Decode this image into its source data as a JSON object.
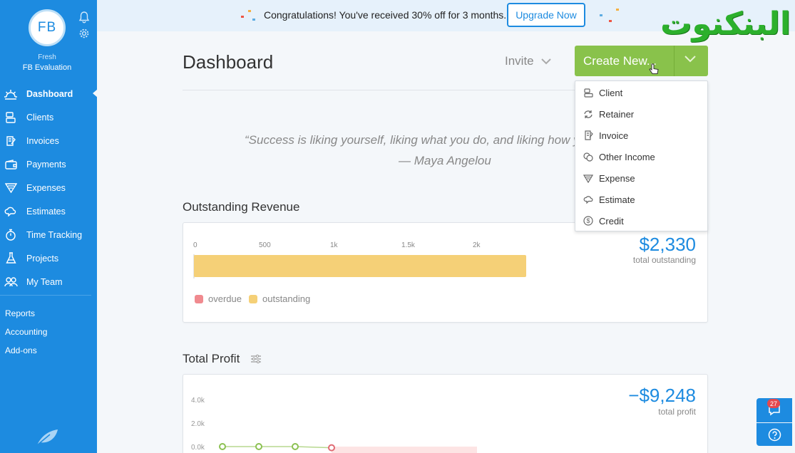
{
  "sidebar": {
    "avatar_initials": "FB",
    "org_subtitle": "Fresh",
    "org_name": "FB Evaluation",
    "items": [
      {
        "label": "Dashboard",
        "icon": "sun-icon",
        "active": true
      },
      {
        "label": "Clients",
        "icon": "clients-icon"
      },
      {
        "label": "Invoices",
        "icon": "invoice-icon"
      },
      {
        "label": "Payments",
        "icon": "wallet-icon"
      },
      {
        "label": "Expenses",
        "icon": "expense-icon"
      },
      {
        "label": "Estimates",
        "icon": "cloud-icon"
      },
      {
        "label": "Time Tracking",
        "icon": "stopwatch-icon"
      },
      {
        "label": "Projects",
        "icon": "flask-icon"
      },
      {
        "label": "My Team",
        "icon": "team-icon"
      }
    ],
    "links": [
      "Reports",
      "Accounting",
      "Add-ons"
    ]
  },
  "banner": {
    "message": "Congratulations! You've received 30% off for 3 months.",
    "button": "Upgrade Now"
  },
  "watermark": "البنكنوت",
  "header": {
    "title": "Dashboard",
    "invite": "Invite",
    "create": "Create New..."
  },
  "dropdown": {
    "items": [
      {
        "label": "Client",
        "icon": "client-icon"
      },
      {
        "label": "Retainer",
        "icon": "refresh-icon"
      },
      {
        "label": "Invoice",
        "icon": "invoice-icon"
      },
      {
        "label": "Other Income",
        "icon": "coins-icon"
      },
      {
        "label": "Expense",
        "icon": "expense-icon"
      },
      {
        "label": "Estimate",
        "icon": "cloud-icon"
      },
      {
        "label": "Credit",
        "icon": "dollar-circle-icon"
      }
    ]
  },
  "quote": {
    "text": "“Success is liking yourself, liking what you do, and liking how you do it.”",
    "author": "— Maya Angelou"
  },
  "outstanding": {
    "title": "Outstanding Revenue",
    "amount": "$2,330",
    "subtitle": "total outstanding",
    "legend_overdue": "overdue",
    "legend_outstanding": "outstanding",
    "colors": {
      "overdue": "#f08a8f",
      "outstanding": "#f5d077"
    }
  },
  "profit": {
    "title": "Total Profit",
    "amount": "−$9,248",
    "subtitle": "total profit"
  },
  "support": {
    "badge": "27"
  },
  "chart_data": [
    {
      "type": "bar",
      "orientation": "horizontal",
      "categories": [
        "total"
      ],
      "series": [
        {
          "name": "overdue",
          "values": [
            0
          ]
        },
        {
          "name": "outstanding",
          "values": [
            2330
          ]
        }
      ],
      "x_ticks": [
        "0",
        "500",
        "1k",
        "1.5k",
        "2k"
      ],
      "xlim": [
        0,
        2500
      ],
      "legend": "bottom-left"
    },
    {
      "type": "line",
      "y_ticks": [
        "4.0k",
        "2.0k",
        "0.0k"
      ],
      "ylim": [
        0,
        4000
      ],
      "points": [
        0,
        0,
        0,
        -100
      ]
    }
  ]
}
